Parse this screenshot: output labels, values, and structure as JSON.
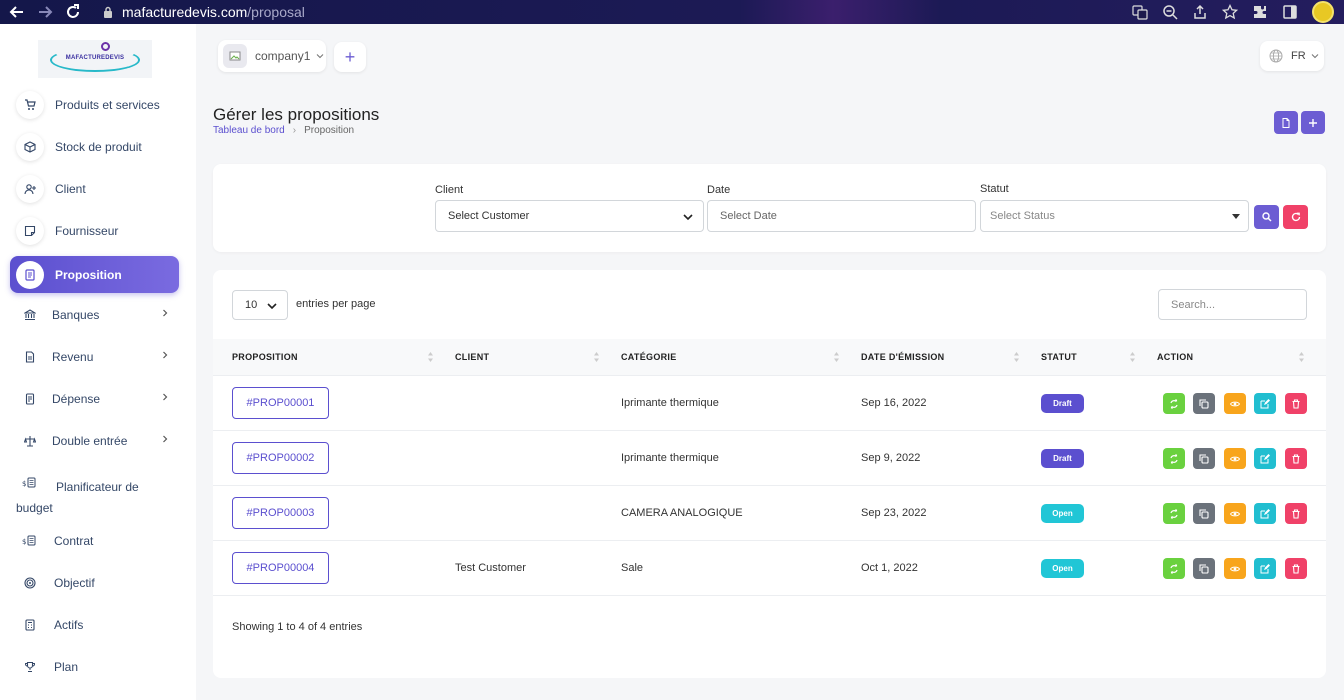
{
  "browser": {
    "url_host": "mafacturedevis.com",
    "url_path": "/proposal"
  },
  "sidebar": {
    "logo_text": "MAFACTUREDEVIS",
    "items": [
      {
        "label": "Produits et services",
        "icon": "cart-icon"
      },
      {
        "label": "Stock de produit",
        "icon": "box-icon"
      },
      {
        "label": "Client",
        "icon": "user-plus-icon"
      },
      {
        "label": "Fournisseur",
        "icon": "sticky-note-icon"
      },
      {
        "label": "Proposition",
        "icon": "document-icon",
        "active": true
      },
      {
        "label": "Banques",
        "icon": "bank-icon",
        "expandable": true
      },
      {
        "label": "Revenu",
        "icon": "file-icon",
        "expandable": true
      },
      {
        "label": "Dépense",
        "icon": "receipt-icon",
        "expandable": true
      },
      {
        "label": "Double entrée",
        "icon": "scale-icon",
        "expandable": true
      },
      {
        "label": "Planificateur de budget",
        "icon": "money-icon"
      },
      {
        "label": "Contrat",
        "icon": "money-icon"
      },
      {
        "label": "Objectif",
        "icon": "target-icon"
      },
      {
        "label": "Actifs",
        "icon": "calculator-icon"
      },
      {
        "label": "Plan",
        "icon": "trophy-icon"
      }
    ]
  },
  "header": {
    "company": "company1",
    "add_symbol": "+",
    "language": "FR"
  },
  "page": {
    "title": "Gérer les propositions",
    "breadcrumb": {
      "home": "Tableau de bord",
      "separator": "›",
      "current": "Proposition"
    }
  },
  "filters": {
    "client_label": "Client",
    "client_value": "Select Customer",
    "date_label": "Date",
    "date_placeholder": "Select Date",
    "status_label": "Statut",
    "status_placeholder": "Select Status"
  },
  "table": {
    "per_page_value": "10",
    "per_page_label": "entries per page",
    "search_placeholder": "Search...",
    "columns": [
      "PROPOSITION",
      "CLIENT",
      "CATÉGORIE",
      "DATE D'ÉMISSION",
      "STATUT",
      "ACTION"
    ],
    "rows": [
      {
        "id": "#PROP00001",
        "client": "",
        "category": "Iprimante thermique",
        "date": "Sep 16, 2022",
        "status": "Draft"
      },
      {
        "id": "#PROP00002",
        "client": "",
        "category": "Iprimante thermique",
        "date": "Sep 9, 2022",
        "status": "Draft"
      },
      {
        "id": "#PROP00003",
        "client": "",
        "category": "CAMERA ANALOGIQUE",
        "date": "Sep 23, 2022",
        "status": "Open"
      },
      {
        "id": "#PROP00004",
        "client": "Test Customer",
        "category": "Sale",
        "date": "Oct 1, 2022",
        "status": "Open"
      }
    ],
    "footer": "Showing 1 to 4 of 4 entries"
  },
  "colors": {
    "primary": "#6c5dd3",
    "draft": "#5b4fcf",
    "open": "#21c6d6",
    "convert": "#6ad13f",
    "duplicate": "#6b727b",
    "view": "#f8a51c",
    "edit": "#21bed0",
    "delete": "#f04168",
    "reset": "#f04168"
  }
}
